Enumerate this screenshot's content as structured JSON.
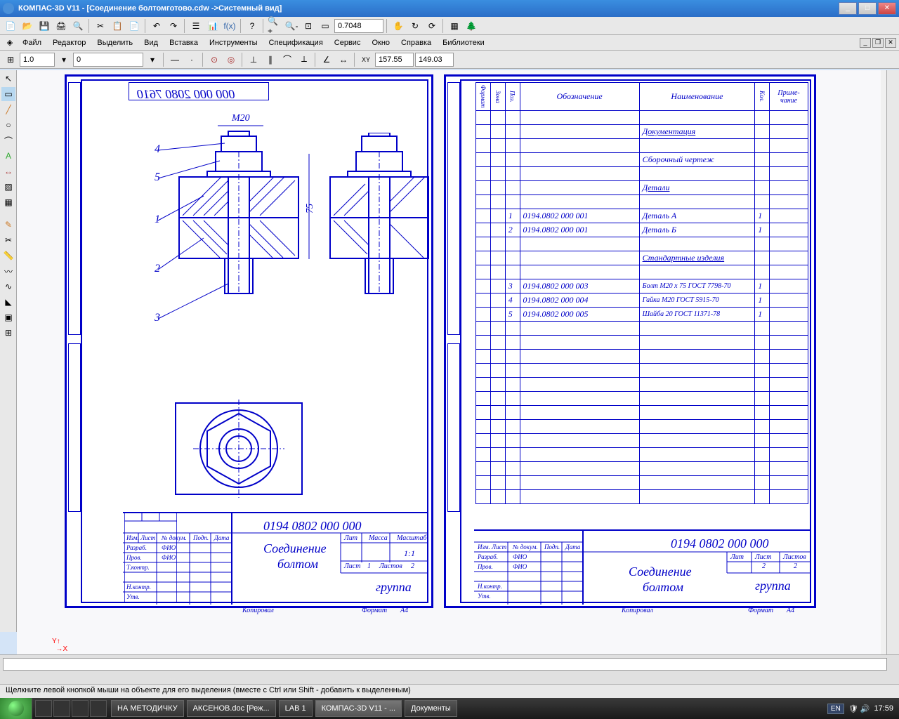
{
  "title": "КОМПАС-3D V11 - [Соединение болтомготово.cdw ->Системный вид]",
  "menu": {
    "file": "Файл",
    "editor": "Редактор",
    "select": "Выделить",
    "view": "Вид",
    "insert": "Вставка",
    "tools": "Инструменты",
    "spec": "Спецификация",
    "service": "Сервис",
    "window": "Окно",
    "help": "Справка",
    "libs": "Библиотеки"
  },
  "toolbar": {
    "zoom": "0.7048",
    "scale": "1.0",
    "zero": "0",
    "coord_x": "157.55",
    "coord_y": "149.03"
  },
  "drawing1": {
    "header_code": "000 000 2080 7610",
    "dim_label": "M20",
    "dim_height": "75",
    "callouts": [
      "4",
      "5",
      "1",
      "2",
      "3"
    ],
    "title_block": {
      "code": "0194 0802 000 000",
      "name_l1": "Соединение",
      "name_l2": "болтом",
      "group": "группа",
      "scale": "1:1",
      "sheet": "Лист",
      "sheet_n": "1",
      "sheets": "Листов",
      "sheets_n": "2",
      "lit": "Лит",
      "mass": "Масса",
      "mastab": "Масштаб",
      "izm": "Изм.",
      "list2": "Лист",
      "ndoc": "№ докум.",
      "podp": "Подп.",
      "data": "Дата",
      "razrab": "Разраб.",
      "prov": "Пров.",
      "tkontr": "Т.контр.",
      "nkontr": "Н.контр.",
      "utv": "Утв.",
      "fio": "ФИО",
      "kopiroval": "Копировал",
      "format": "Формат",
      "fmt": "A4"
    }
  },
  "drawing2": {
    "headers": {
      "fmt": "Формат",
      "zone": "Зона",
      "pos": "Поз.",
      "designation": "Обозначение",
      "name": "Наименование",
      "qty": "Кол.",
      "note": "Приме-\nчание"
    },
    "sections": {
      "docs": "Документация",
      "assembly": "Сборочный чертеж",
      "parts": "Детали",
      "standard": "Стандартные изделия"
    },
    "rows": [
      {
        "pos": "1",
        "des": "0194.0802 000 001",
        "name": "Деталь А",
        "qty": "1"
      },
      {
        "pos": "2",
        "des": "0194.0802 000 001",
        "name": "Деталь Б",
        "qty": "1"
      },
      {
        "pos": "3",
        "des": "0194.0802 000 003",
        "name": "Болт М20 х 75 ГОСТ 7798-70",
        "qty": "1"
      },
      {
        "pos": "4",
        "des": "0194.0802 000 004",
        "name": "Гайка М20 ГОСТ 5915-70",
        "qty": "1"
      },
      {
        "pos": "5",
        "des": "0194.0802 000 005",
        "name": "Шайба 20 ГОСТ 11371-78",
        "qty": "1"
      }
    ],
    "title_block": {
      "code": "0194 0802 000 000",
      "name_l1": "Соединение",
      "name_l2": "болтом",
      "group": "группа",
      "sheet": "Лист",
      "sheet_n": "2",
      "sheets": "Листов",
      "sheets_n": "2",
      "lit": "Лит"
    }
  },
  "status": "Щелкните левой кнопкой мыши на объекте для его выделения (вместе с Ctrl или Shift - добавить к выделенным)",
  "taskbar": {
    "t1": "НА МЕТОДИЧКУ",
    "t2": "АКСЕНОВ.doc [Реж...",
    "t3": "LAB 1",
    "t4": "КОМПАС-3D V11 - ...",
    "t5": "Документы",
    "lang": "EN",
    "time": "17:59"
  }
}
